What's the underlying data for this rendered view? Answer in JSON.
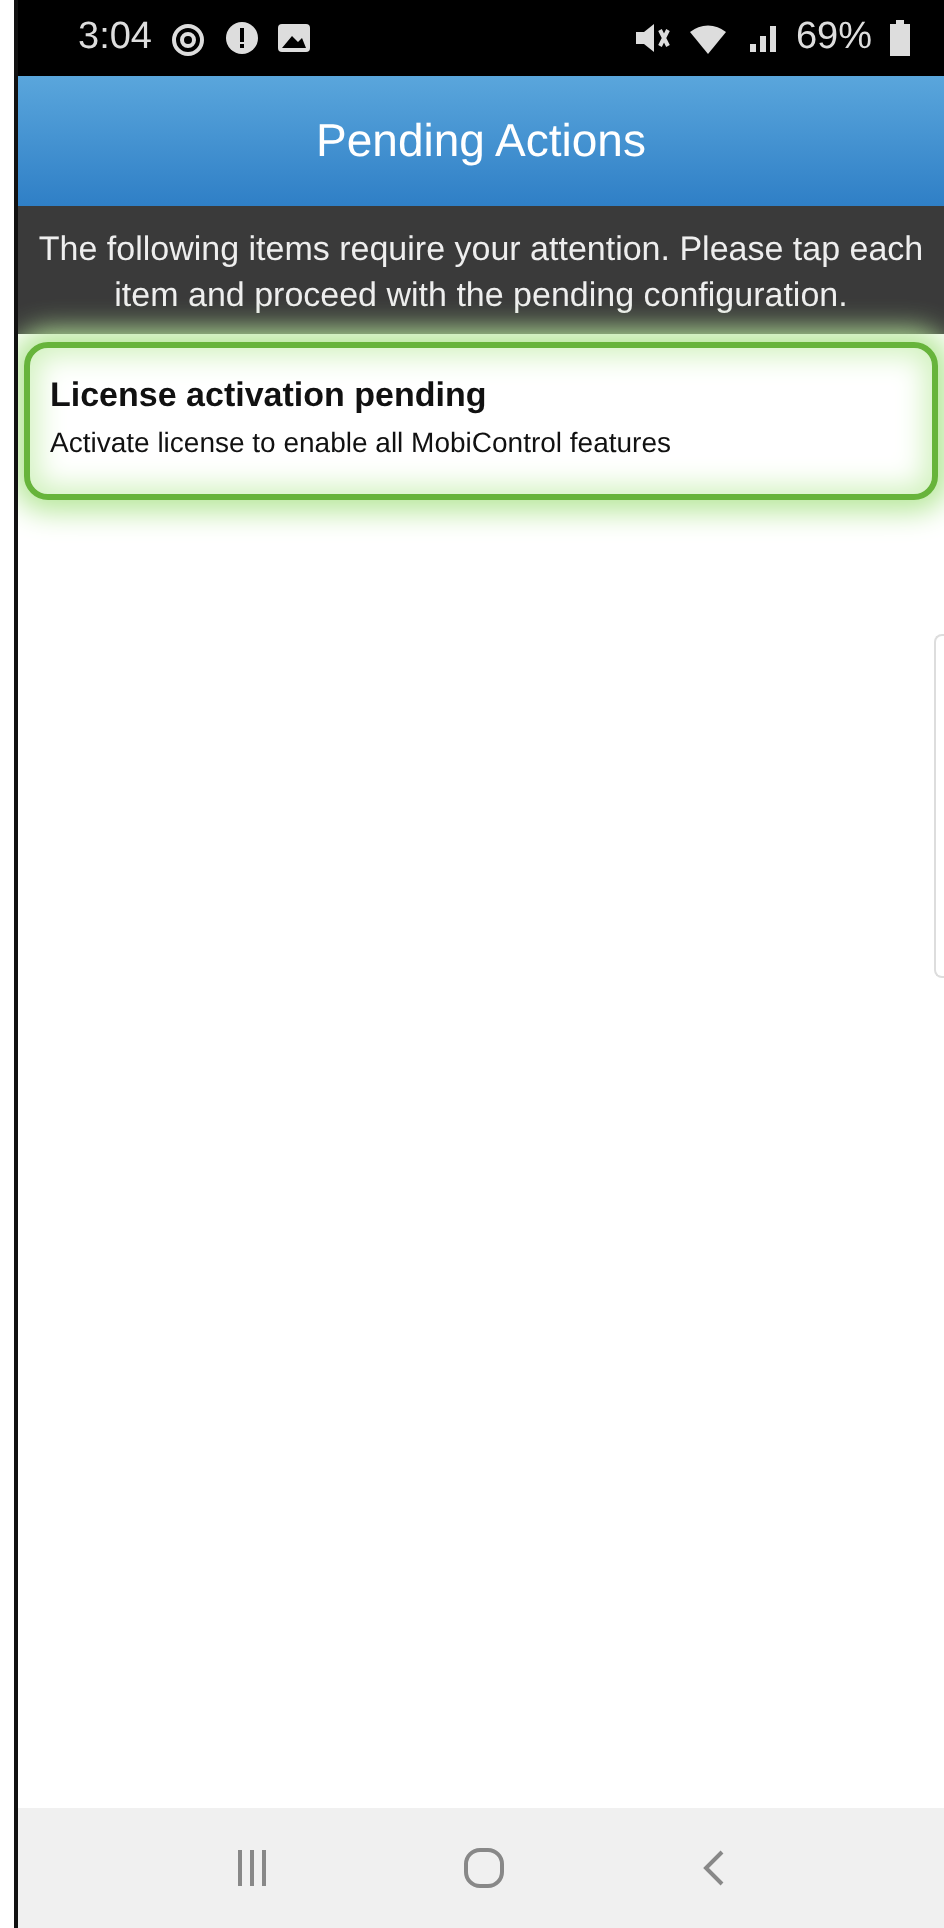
{
  "status_bar": {
    "time": "3:04",
    "battery": "69%"
  },
  "title": "Pending Actions",
  "message": "The following items require your attention. Please tap each item and proceed with the pending configuration.",
  "items": [
    {
      "title": "License activation pending",
      "subtitle": "Activate license to enable all MobiControl features",
      "highlighted": true
    }
  ]
}
